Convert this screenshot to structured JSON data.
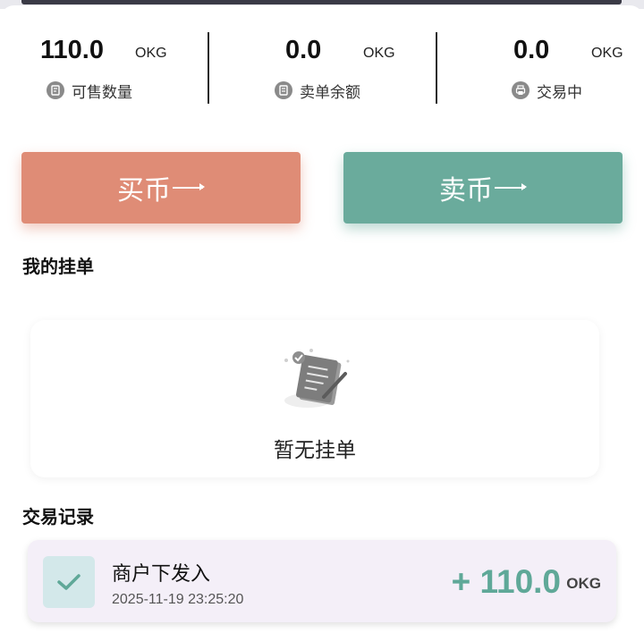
{
  "stats": [
    {
      "value": "110.0",
      "unit": "OKG",
      "label": "可售数量",
      "icon": "document-icon"
    },
    {
      "value": "0.0",
      "unit": "OKG",
      "label": "卖单余额",
      "icon": "document-icon"
    },
    {
      "value": "0.0",
      "unit": "OKG",
      "label": "交易中",
      "icon": "printer-icon"
    }
  ],
  "actions": {
    "buy_label": "买币",
    "sell_label": "卖币",
    "buy_color": "#df8c76",
    "sell_color": "#6aab9c"
  },
  "my_orders": {
    "title": "我的挂单",
    "empty_text": "暂无挂单"
  },
  "records": {
    "title": "交易记录",
    "items": [
      {
        "title": "商户下发入",
        "time": "2025-11-19 23:25:20",
        "amount": "+ 110.0",
        "unit": "OKG",
        "status_icon": "check-icon"
      }
    ]
  }
}
